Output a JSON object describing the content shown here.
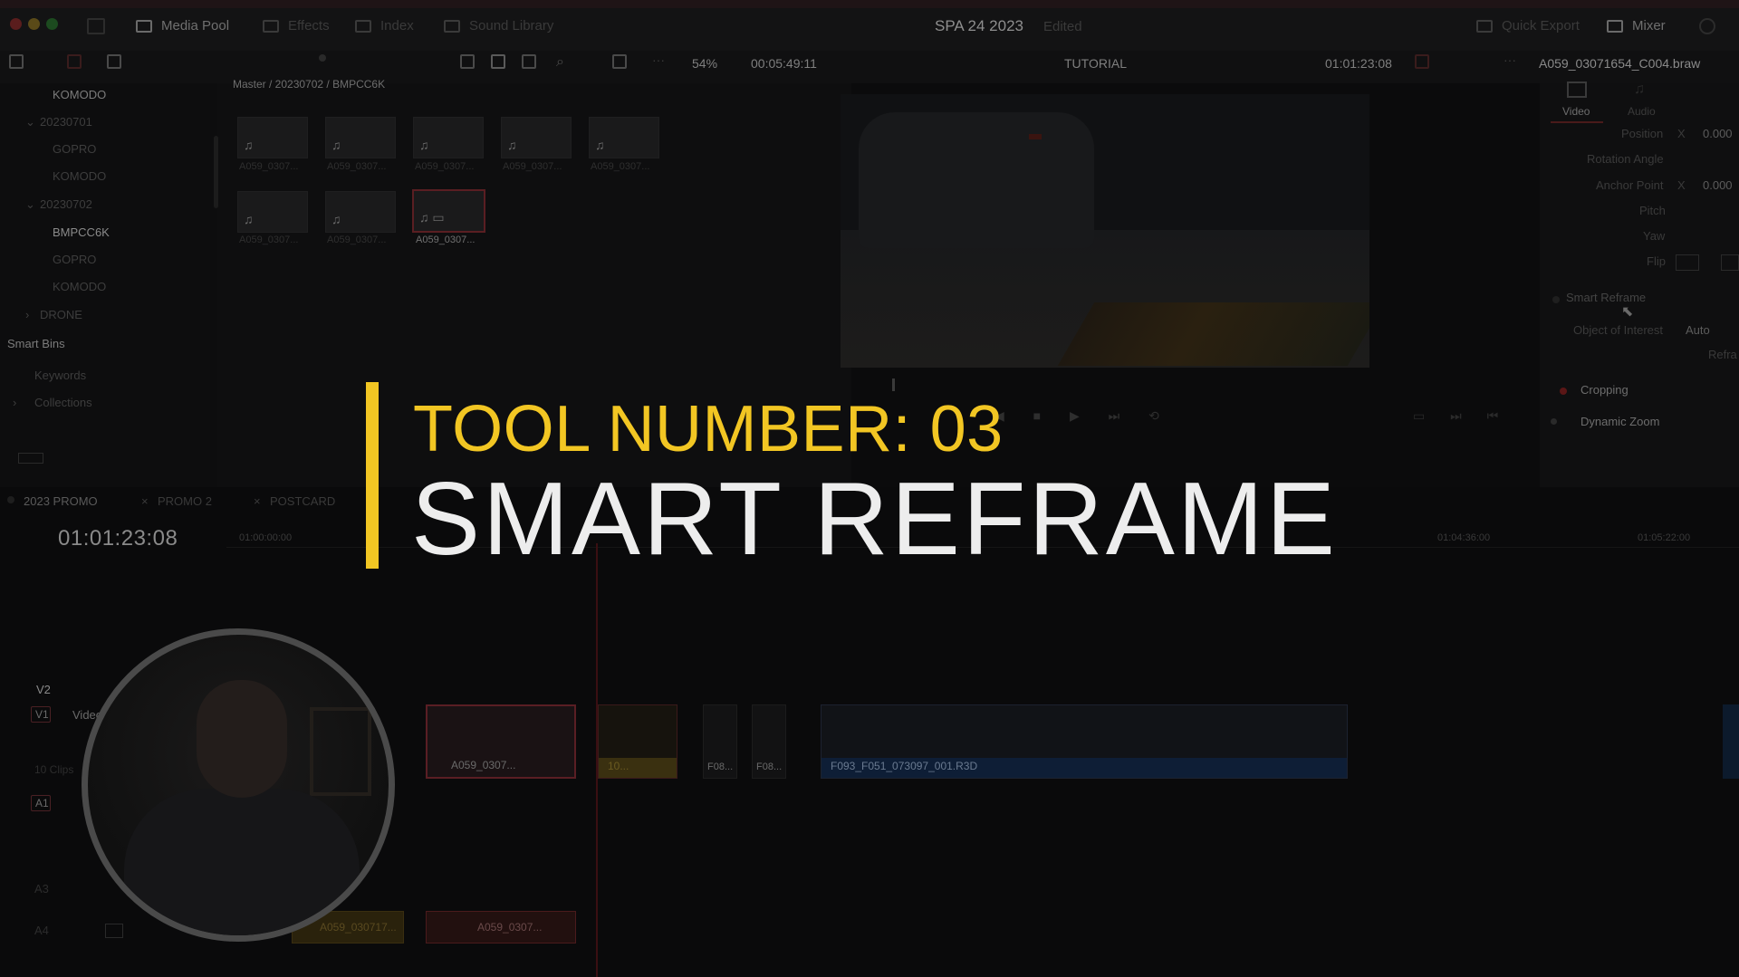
{
  "menu": {
    "media_pool": "Media Pool",
    "effects": "Effects",
    "index": "Index",
    "sound_library": "Sound Library",
    "project_title": "SPA 24 2023",
    "edited": "Edited",
    "quick_export": "Quick Export",
    "mixer": "Mixer"
  },
  "toolbar": {
    "zoom": "54%",
    "duration": "00:05:49:11",
    "timeline_name": "TUTORIAL",
    "timecode": "01:01:23:08",
    "clip_name": "A059_03071654_C004.braw"
  },
  "bins": {
    "items": [
      "KOMODO",
      "20230701",
      "GOPRO",
      "KOMODO",
      "20230702",
      "BMPCC6K",
      "GOPRO",
      "KOMODO",
      "DRONE"
    ],
    "smart_bins": "Smart Bins",
    "keywords": "Keywords",
    "collections": "Collections"
  },
  "media_pool": {
    "breadcrumb": "Master / 20230702 / BMPCC6K",
    "clips": [
      "A059_0307...",
      "A059_0307...",
      "A059_0307...",
      "A059_0307...",
      "A059_0307...",
      "A059_0307...",
      "A059_0307...",
      "A059_0307..."
    ]
  },
  "inspector": {
    "tabs": [
      "Video",
      "Audio"
    ],
    "position": "Position",
    "x": "X",
    "position_x": "0.000",
    "rotation_angle": "Rotation Angle",
    "anchor_point": "Anchor Point",
    "anchor_x": "0.000",
    "pitch": "Pitch",
    "yaw": "Yaw",
    "flip": "Flip",
    "smart_reframe": "Smart Reframe",
    "object_of_interest": "Object of Interest",
    "auto": "Auto",
    "reframe": "Refra",
    "cropping": "Cropping",
    "dynamic_zoom": "Dynamic Zoom"
  },
  "timeline": {
    "tabs": [
      "2023 PROMO",
      "PROMO 2",
      "POSTCARD"
    ],
    "timecode": "01:01:23:08",
    "ruler": [
      "01:00:00:00",
      "01:04:36:00",
      "01:05:22:00"
    ],
    "tracks": [
      "V2",
      "V1",
      "Video 1",
      "10 Clips",
      "A1",
      "A3",
      "A4"
    ],
    "clips": [
      "A059_0307...",
      "10...",
      "F08...",
      "F08...",
      "F093_F051_073097_001.R3D",
      "A059_030717...",
      "A059_0307..."
    ]
  },
  "overlay": {
    "tool_number": "TOOL NUMBER: 03",
    "title": "SMART REFRAME"
  },
  "colors": {
    "accent_yellow": "#f2c623",
    "title_white": "#ededed",
    "clip_red": "#5a1e24",
    "clip_yellow": "#4a3f10",
    "clip_blue": "#102440"
  }
}
